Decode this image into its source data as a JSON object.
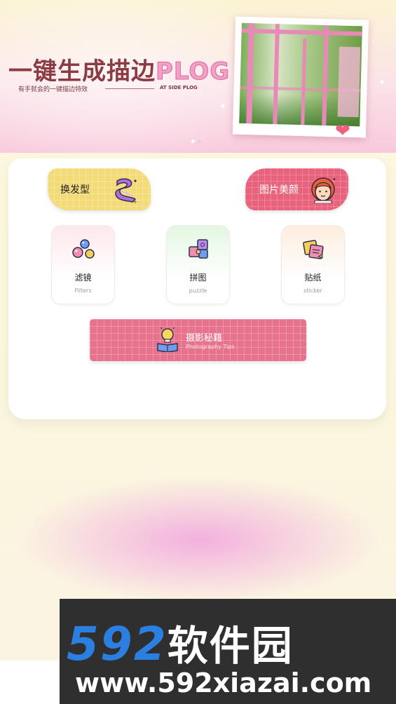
{
  "banner": {
    "title_main": "一键生成描边",
    "title_accent": "PLOG",
    "subtitle": "有手就会的一键描边特效",
    "subtitle_en": "AT SIDE PLOG",
    "carousel_index": 1,
    "carousel_count": 2
  },
  "features": {
    "hair": {
      "label": "换发型",
      "icon": "purple-hair-swirl-icon"
    },
    "beauty": {
      "label": "图片美颜",
      "icon": "girl-face-icon"
    }
  },
  "tiles": [
    {
      "label": "滤镜",
      "sub": "Filters",
      "icon": "bubbles-icon"
    },
    {
      "label": "拼图",
      "sub": "puzzle",
      "icon": "puzzle-icon"
    },
    {
      "label": "贴纸",
      "sub": "sticker",
      "icon": "sticker-icon"
    }
  ],
  "tips": {
    "label": "摄影秘籍",
    "sub": "Photography Tips",
    "icon": "lightbulb-book-icon"
  },
  "watermark": {
    "brand_num": "592",
    "brand_cn": "软件园",
    "url": "www.592xiazai.com"
  },
  "colors": {
    "hair_pill": "#f3db78",
    "beauty_pill": "#e9627c",
    "tips_button": "#e7728d",
    "title_brown": "#8a3b43",
    "plog_pink": "#f2a0c6"
  }
}
